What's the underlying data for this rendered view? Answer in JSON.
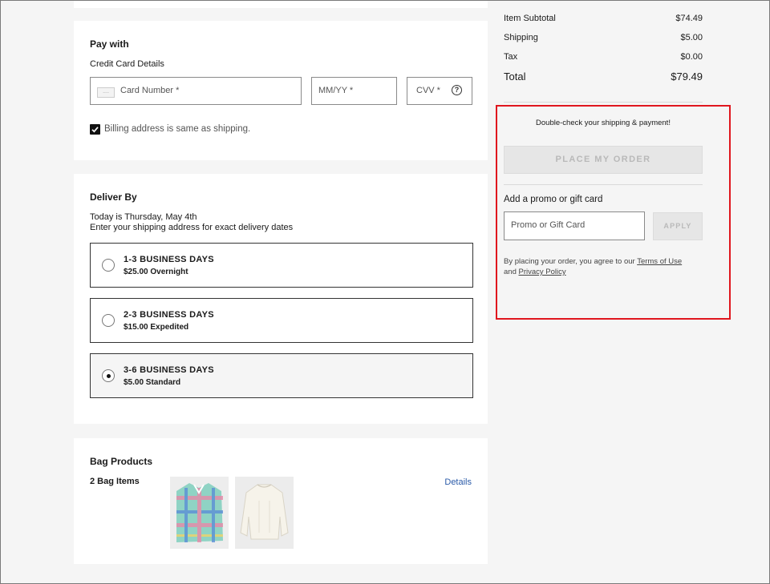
{
  "pay": {
    "heading": "Pay with",
    "subheading": "Credit Card Details",
    "card_number_placeholder": "Card Number *",
    "card_icon_text": "....",
    "expiry_placeholder": "MM/YY *",
    "cvv_placeholder": "CVV *",
    "help_glyph": "?",
    "billing_same_label": "Billing address is same as shipping.",
    "billing_same_checked": true
  },
  "deliver": {
    "heading": "Deliver By",
    "today_text": "Today is Thursday, May 4th",
    "instruction": "Enter your shipping address for exact delivery dates",
    "options": [
      {
        "title": "1-3 BUSINESS DAYS",
        "detail": "$25.00 Overnight",
        "selected": false
      },
      {
        "title": "2-3 BUSINESS DAYS",
        "detail": "$15.00 Expedited",
        "selected": false
      },
      {
        "title": "3-6 BUSINESS DAYS",
        "detail": "$5.00 Standard",
        "selected": true
      }
    ]
  },
  "bag": {
    "heading": "Bag Products",
    "count_label": "2 Bag Items",
    "details_link": "Details",
    "items": [
      {
        "icon": "plaid-shirt-image"
      },
      {
        "icon": "white-blouse-image"
      }
    ]
  },
  "summary": {
    "subtotal_label": "Item Subtotal",
    "subtotal_value": "$74.49",
    "shipping_label": "Shipping",
    "shipping_value": "$5.00",
    "tax_label": "Tax",
    "tax_value": "$0.00",
    "total_label": "Total",
    "total_value": "$79.49"
  },
  "order": {
    "notice": "Double-check your shipping & payment!",
    "place_order_label": "PLACE MY ORDER",
    "promo_heading": "Add a promo or gift card",
    "promo_placeholder": "Promo or Gift Card",
    "apply_label": "APPLY",
    "legal_prefix": "By placing your order, you agree to our",
    "terms_link": "Terms of Use",
    "legal_and": "and",
    "privacy_link": "Privacy Policy"
  },
  "colors": {
    "highlight": "#e0161e",
    "link": "#2a5aa8",
    "disabled_button": "#e6e6e6"
  }
}
